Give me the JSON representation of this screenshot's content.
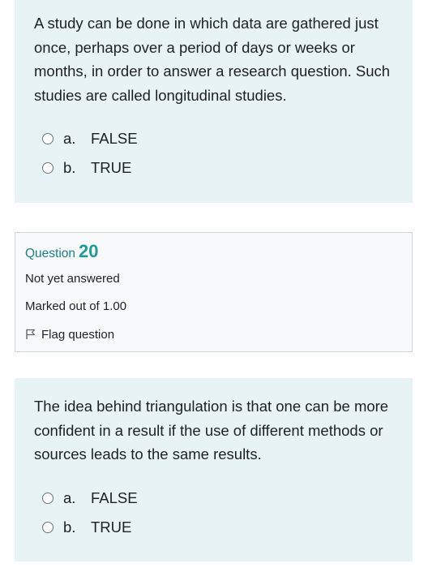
{
  "questions": [
    {
      "text": "A study can be done in which data are gathered just once, perhaps over a period of days or weeks or months, in order to answer a research question. Such studies are called longitudinal studies.",
      "answers": [
        {
          "letter": "a.",
          "label": "FALSE"
        },
        {
          "letter": "b.",
          "label": "TRUE"
        }
      ]
    },
    {
      "text": "The idea behind triangulation is that one can be more confident in a result if the use of different methods or sources leads to the same results.",
      "answers": [
        {
          "letter": "a.",
          "label": "FALSE"
        },
        {
          "letter": "b.",
          "label": "TRUE"
        }
      ]
    }
  ],
  "info": {
    "question_label": "Question",
    "question_number": "20",
    "status": "Not yet answered",
    "marks": "Marked out of 1.00",
    "flag_label": "Flag question",
    "flag_icon": "flag-outline-icon"
  },
  "colors": {
    "qtext_bg": "#e7f3f5",
    "info_bg": "#f8f9fa",
    "question_number": "#1f9a9a"
  }
}
